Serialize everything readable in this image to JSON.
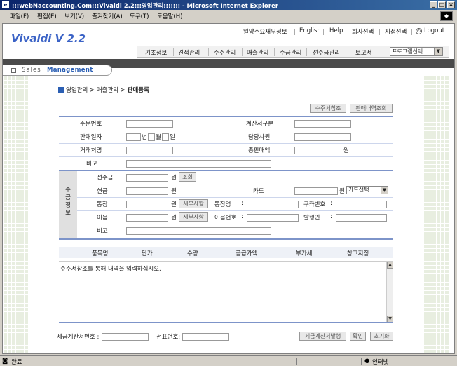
{
  "window": {
    "title": ":::webNaccounting.Com:::Vivaldi 2.2:::영업관리::::::: - Microsoft Internet Explorer",
    "icon": "ie-icon"
  },
  "menu": [
    "파일(F)",
    "편집(E)",
    "보기(V)",
    "즐겨찾기(A)",
    "도구(T)",
    "도움말(H)"
  ],
  "header": {
    "logo": "Vivaldi  V 2.2",
    "top_links": [
      "일양주요재무정보",
      "English",
      "Help",
      "회사선택",
      "지점선택",
      "Logout"
    ],
    "nav": [
      "기초정보",
      "견적관리",
      "수주관리",
      "매출관리",
      "수금관리",
      "선수금관리",
      "보고서"
    ],
    "program_select": "프로그램선택",
    "sales_label": "Sales",
    "management_label": "Management"
  },
  "breadcrumb": {
    "path": "영업관리 > 매출관리 > ",
    "current": "판매등록"
  },
  "buttons": {
    "order_ref": "수주서참조",
    "sales_history": "판매내역조회",
    "lookup": "조회",
    "detail1": "세부사항",
    "detail2": "세부사항",
    "tax_issue": "세금계산서발행",
    "confirm": "확인",
    "reset": "초기화"
  },
  "form": {
    "order_no": "주문번호",
    "invoice_type": "계산서구분",
    "sale_date": "판매일자",
    "year": "년",
    "month": "월",
    "day": "일",
    "manager": "담당사원",
    "client": "거래처명",
    "total_amount": "총판매액",
    "won": "원",
    "note": "비고"
  },
  "payment": {
    "section_title": "수금정보",
    "prepaid": "선수금",
    "cash": "현금",
    "card": "카드",
    "card_select": "카드선택",
    "bank": "통장",
    "bank_name": "통장명",
    "account_no": "구좌번호",
    "bill": "어음",
    "bill_no": "어음번호",
    "issuer": "발행인",
    "note": "비고",
    "colon": ":"
  },
  "table": {
    "headers": [
      "품목명",
      "단가",
      "수량",
      "공급가액",
      "부가세",
      "창고지정"
    ],
    "message": "수주서참조를 통해 내역을 입력하십시오."
  },
  "footer": {
    "tax_invoice_no": "세금계산서번호 :",
    "slip_no": "전표번호:"
  },
  "status": {
    "left": "완료",
    "right": "인터넷"
  },
  "colors": {
    "accent": "#2b5fb3",
    "rule": "#7d94c9",
    "title_bar": "#0a246a"
  }
}
